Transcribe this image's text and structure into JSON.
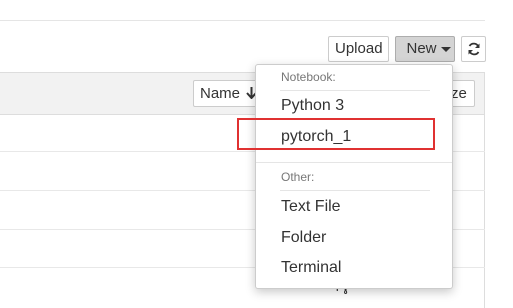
{
  "toolbar": {
    "upload_label": "Upload",
    "new_label": "New",
    "refresh_icon": "refresh-icon"
  },
  "list": {
    "name_sort_label": "Name",
    "size_sort_label": "ze"
  },
  "new_menu": {
    "notebook_header": "Notebook:",
    "notebook_items": [
      "Python 3",
      "pytorch_1"
    ],
    "other_header": "Other:",
    "other_items": [
      "Text File",
      "Folder",
      "Terminal"
    ]
  },
  "highlight_color": "#e03131"
}
